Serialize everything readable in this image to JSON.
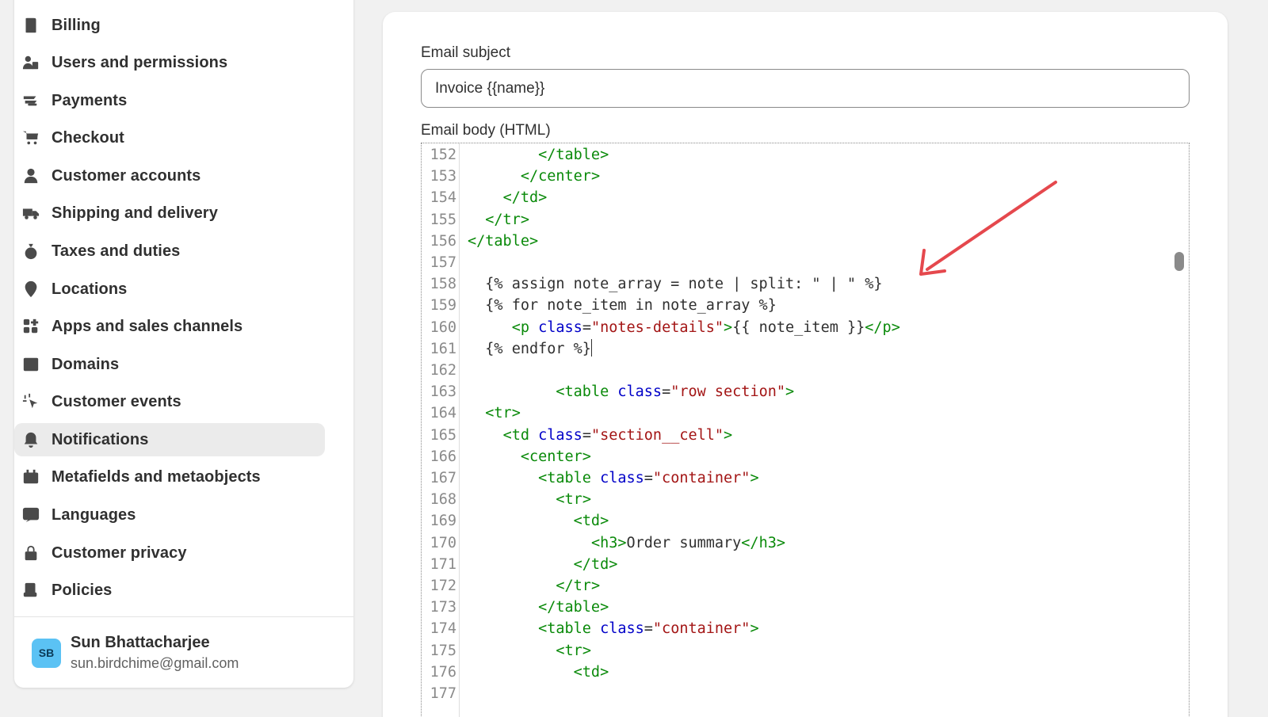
{
  "nav": {
    "items": [
      {
        "label": "Billing",
        "icon": "billing-icon"
      },
      {
        "label": "Users and permissions",
        "icon": "users-icon"
      },
      {
        "label": "Payments",
        "icon": "payments-icon"
      },
      {
        "label": "Checkout",
        "icon": "cart-icon"
      },
      {
        "label": "Customer accounts",
        "icon": "person-icon"
      },
      {
        "label": "Shipping and delivery",
        "icon": "truck-icon"
      },
      {
        "label": "Taxes and duties",
        "icon": "tax-icon"
      },
      {
        "label": "Locations",
        "icon": "location-pin-icon"
      },
      {
        "label": "Apps and sales channels",
        "icon": "apps-icon"
      },
      {
        "label": "Domains",
        "icon": "domains-icon"
      },
      {
        "label": "Customer events",
        "icon": "cursor-click-icon"
      },
      {
        "label": "Notifications",
        "icon": "bell-icon",
        "active": true
      },
      {
        "label": "Metafields and metaobjects",
        "icon": "metafields-icon"
      },
      {
        "label": "Languages",
        "icon": "languages-icon"
      },
      {
        "label": "Customer privacy",
        "icon": "lock-icon"
      },
      {
        "label": "Policies",
        "icon": "policies-icon"
      }
    ]
  },
  "user": {
    "initials": "SB",
    "name": "Sun Bhattacharjee",
    "email": "sun.birdchime@gmail.com"
  },
  "form": {
    "subject_label": "Email subject",
    "subject_value": "Invoice {{name}}",
    "body_label": "Email body (HTML)"
  },
  "editor": {
    "lines": [
      {
        "n": "152",
        "code": "        </table>"
      },
      {
        "n": "153",
        "code": "      </center>"
      },
      {
        "n": "154",
        "code": "    </td>"
      },
      {
        "n": "155",
        "code": "  </tr>"
      },
      {
        "n": "156",
        "code": "</table>"
      },
      {
        "n": "157",
        "code": ""
      },
      {
        "n": "158",
        "code": "  {% assign note_array = note | split: \" | \" %}"
      },
      {
        "n": "159",
        "code": "  {% for note_item in note_array %}"
      },
      {
        "n": "160",
        "code": "     <p class=\"notes-details\">{{ note_item }}</p>"
      },
      {
        "n": "161",
        "code": "  {% endfor %}"
      },
      {
        "n": "162",
        "code": ""
      },
      {
        "n": "163",
        "code": "          <table class=\"row section\">"
      },
      {
        "n": "164",
        "code": "  <tr>"
      },
      {
        "n": "165",
        "code": "    <td class=\"section__cell\">"
      },
      {
        "n": "166",
        "code": "      <center>"
      },
      {
        "n": "167",
        "code": "        <table class=\"container\">"
      },
      {
        "n": "168",
        "code": "          <tr>"
      },
      {
        "n": "169",
        "code": "            <td>"
      },
      {
        "n": "170",
        "code": "              <h3>Order summary</h3>"
      },
      {
        "n": "171",
        "code": "            </td>"
      },
      {
        "n": "172",
        "code": "          </tr>"
      },
      {
        "n": "173",
        "code": "        </table>"
      },
      {
        "n": "174",
        "code": "        <table class=\"container\">"
      },
      {
        "n": "175",
        "code": "          <tr>"
      },
      {
        "n": "176",
        "code": "            <td>"
      },
      {
        "n": "177",
        "code": ""
      }
    ],
    "cursor_line": "161"
  },
  "colors": {
    "accent_arrow": "#e5484d",
    "tag": "#0a8a0a",
    "attr": "#0000c8",
    "string": "#a31515",
    "avatar": "#5bc2f4"
  }
}
